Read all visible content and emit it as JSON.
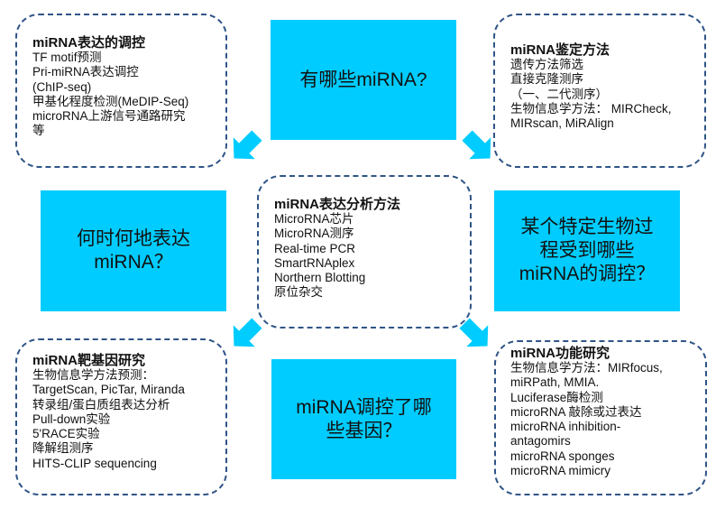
{
  "diagram": {
    "questions": {
      "top": [
        "有哪些miRNA?"
      ],
      "left": [
        "何时何地表达",
        "miRNA？"
      ],
      "right": [
        "某个特定生物过",
        "程受到哪些",
        "miRNA的调控？"
      ],
      "bottom": [
        "miRNA调控了哪",
        "些基因？"
      ]
    },
    "boxes": {
      "regulation": {
        "title": "miRNA表达的调控",
        "lines": [
          "TF motif预测",
          "Pri-miRNA表达调控",
          "(ChIP-seq)",
          "甲基化程度检测(MeDIP-Seq)",
          "microRNA上游信号通路研究",
          "等"
        ]
      },
      "identification": {
        "title": "miRNA鉴定方法",
        "lines": [
          "遗传方法筛选",
          "直接克隆测序",
          "（一、二代测序）",
          "生物信息学方法： MIRCheck,",
          "MIRscan, MiRAlign"
        ]
      },
      "expression": {
        "title": "miRNA表达分析方法",
        "lines": [
          "MicroRNA芯片",
          "MicroRNA测序",
          "Real-time PCR",
          "SmartRNAplex",
          "Northern Blotting",
          "原位杂交"
        ]
      },
      "target": {
        "title": "miRNA靶基因研究",
        "lines": [
          "生物信息学方法预测：",
          "TargetScan, PicTar, Miranda",
          "转录组/蛋白质组表达分析",
          "Pull-down实验",
          "5'RACE实验",
          "降解组测序",
          "HITS-CLIP sequencing"
        ]
      },
      "function": {
        "title": "miRNA功能研究",
        "lines": [
          "生物信息学方法：MIRfocus,",
          "miRPath, MMIA.",
          "Luciferase酶检测",
          "microRNA 敲除或过表达",
          "microRNA inhibition-",
          "antagomirs",
          "microRNA sponges",
          "microRNA mimicry"
        ]
      }
    },
    "colors": {
      "question_fill": "#00ccff",
      "dash_border": "#2f5487",
      "arrow": "#00ccff"
    }
  }
}
